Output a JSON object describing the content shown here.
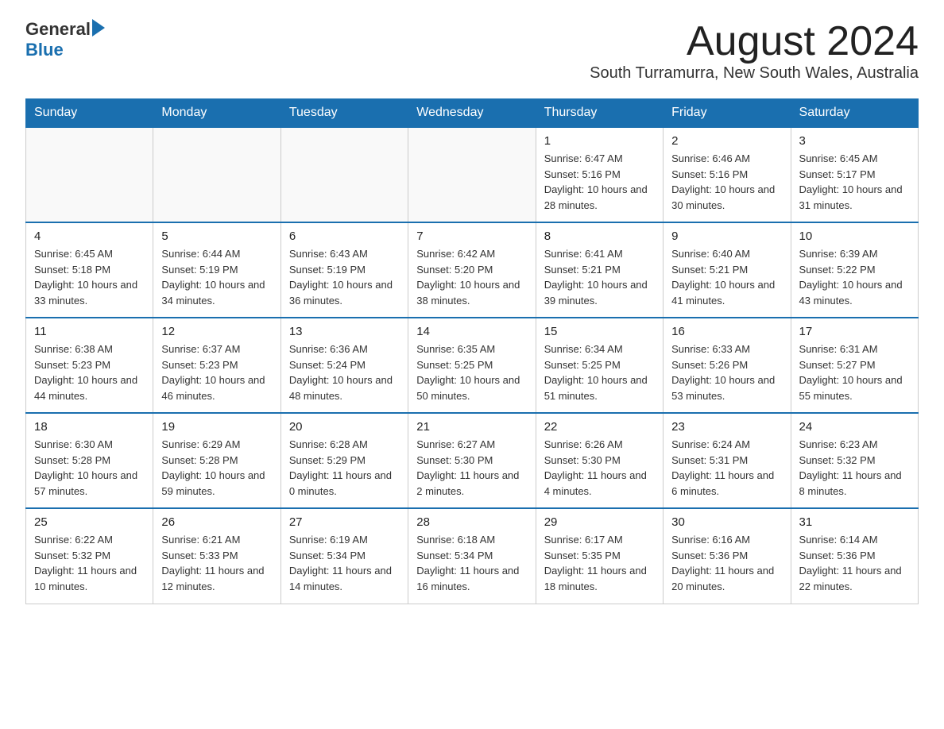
{
  "header": {
    "logo_general": "General",
    "logo_blue": "Blue",
    "page_title": "August 2024",
    "subtitle": "South Turramurra, New South Wales, Australia"
  },
  "calendar": {
    "days_of_week": [
      "Sunday",
      "Monday",
      "Tuesday",
      "Wednesday",
      "Thursday",
      "Friday",
      "Saturday"
    ],
    "weeks": [
      [
        {
          "day": "",
          "info": ""
        },
        {
          "day": "",
          "info": ""
        },
        {
          "day": "",
          "info": ""
        },
        {
          "day": "",
          "info": ""
        },
        {
          "day": "1",
          "info": "Sunrise: 6:47 AM\nSunset: 5:16 PM\nDaylight: 10 hours and 28 minutes."
        },
        {
          "day": "2",
          "info": "Sunrise: 6:46 AM\nSunset: 5:16 PM\nDaylight: 10 hours and 30 minutes."
        },
        {
          "day": "3",
          "info": "Sunrise: 6:45 AM\nSunset: 5:17 PM\nDaylight: 10 hours and 31 minutes."
        }
      ],
      [
        {
          "day": "4",
          "info": "Sunrise: 6:45 AM\nSunset: 5:18 PM\nDaylight: 10 hours and 33 minutes."
        },
        {
          "day": "5",
          "info": "Sunrise: 6:44 AM\nSunset: 5:19 PM\nDaylight: 10 hours and 34 minutes."
        },
        {
          "day": "6",
          "info": "Sunrise: 6:43 AM\nSunset: 5:19 PM\nDaylight: 10 hours and 36 minutes."
        },
        {
          "day": "7",
          "info": "Sunrise: 6:42 AM\nSunset: 5:20 PM\nDaylight: 10 hours and 38 minutes."
        },
        {
          "day": "8",
          "info": "Sunrise: 6:41 AM\nSunset: 5:21 PM\nDaylight: 10 hours and 39 minutes."
        },
        {
          "day": "9",
          "info": "Sunrise: 6:40 AM\nSunset: 5:21 PM\nDaylight: 10 hours and 41 minutes."
        },
        {
          "day": "10",
          "info": "Sunrise: 6:39 AM\nSunset: 5:22 PM\nDaylight: 10 hours and 43 minutes."
        }
      ],
      [
        {
          "day": "11",
          "info": "Sunrise: 6:38 AM\nSunset: 5:23 PM\nDaylight: 10 hours and 44 minutes."
        },
        {
          "day": "12",
          "info": "Sunrise: 6:37 AM\nSunset: 5:23 PM\nDaylight: 10 hours and 46 minutes."
        },
        {
          "day": "13",
          "info": "Sunrise: 6:36 AM\nSunset: 5:24 PM\nDaylight: 10 hours and 48 minutes."
        },
        {
          "day": "14",
          "info": "Sunrise: 6:35 AM\nSunset: 5:25 PM\nDaylight: 10 hours and 50 minutes."
        },
        {
          "day": "15",
          "info": "Sunrise: 6:34 AM\nSunset: 5:25 PM\nDaylight: 10 hours and 51 minutes."
        },
        {
          "day": "16",
          "info": "Sunrise: 6:33 AM\nSunset: 5:26 PM\nDaylight: 10 hours and 53 minutes."
        },
        {
          "day": "17",
          "info": "Sunrise: 6:31 AM\nSunset: 5:27 PM\nDaylight: 10 hours and 55 minutes."
        }
      ],
      [
        {
          "day": "18",
          "info": "Sunrise: 6:30 AM\nSunset: 5:28 PM\nDaylight: 10 hours and 57 minutes."
        },
        {
          "day": "19",
          "info": "Sunrise: 6:29 AM\nSunset: 5:28 PM\nDaylight: 10 hours and 59 minutes."
        },
        {
          "day": "20",
          "info": "Sunrise: 6:28 AM\nSunset: 5:29 PM\nDaylight: 11 hours and 0 minutes."
        },
        {
          "day": "21",
          "info": "Sunrise: 6:27 AM\nSunset: 5:30 PM\nDaylight: 11 hours and 2 minutes."
        },
        {
          "day": "22",
          "info": "Sunrise: 6:26 AM\nSunset: 5:30 PM\nDaylight: 11 hours and 4 minutes."
        },
        {
          "day": "23",
          "info": "Sunrise: 6:24 AM\nSunset: 5:31 PM\nDaylight: 11 hours and 6 minutes."
        },
        {
          "day": "24",
          "info": "Sunrise: 6:23 AM\nSunset: 5:32 PM\nDaylight: 11 hours and 8 minutes."
        }
      ],
      [
        {
          "day": "25",
          "info": "Sunrise: 6:22 AM\nSunset: 5:32 PM\nDaylight: 11 hours and 10 minutes."
        },
        {
          "day": "26",
          "info": "Sunrise: 6:21 AM\nSunset: 5:33 PM\nDaylight: 11 hours and 12 minutes."
        },
        {
          "day": "27",
          "info": "Sunrise: 6:19 AM\nSunset: 5:34 PM\nDaylight: 11 hours and 14 minutes."
        },
        {
          "day": "28",
          "info": "Sunrise: 6:18 AM\nSunset: 5:34 PM\nDaylight: 11 hours and 16 minutes."
        },
        {
          "day": "29",
          "info": "Sunrise: 6:17 AM\nSunset: 5:35 PM\nDaylight: 11 hours and 18 minutes."
        },
        {
          "day": "30",
          "info": "Sunrise: 6:16 AM\nSunset: 5:36 PM\nDaylight: 11 hours and 20 minutes."
        },
        {
          "day": "31",
          "info": "Sunrise: 6:14 AM\nSunset: 5:36 PM\nDaylight: 11 hours and 22 minutes."
        }
      ]
    ]
  }
}
